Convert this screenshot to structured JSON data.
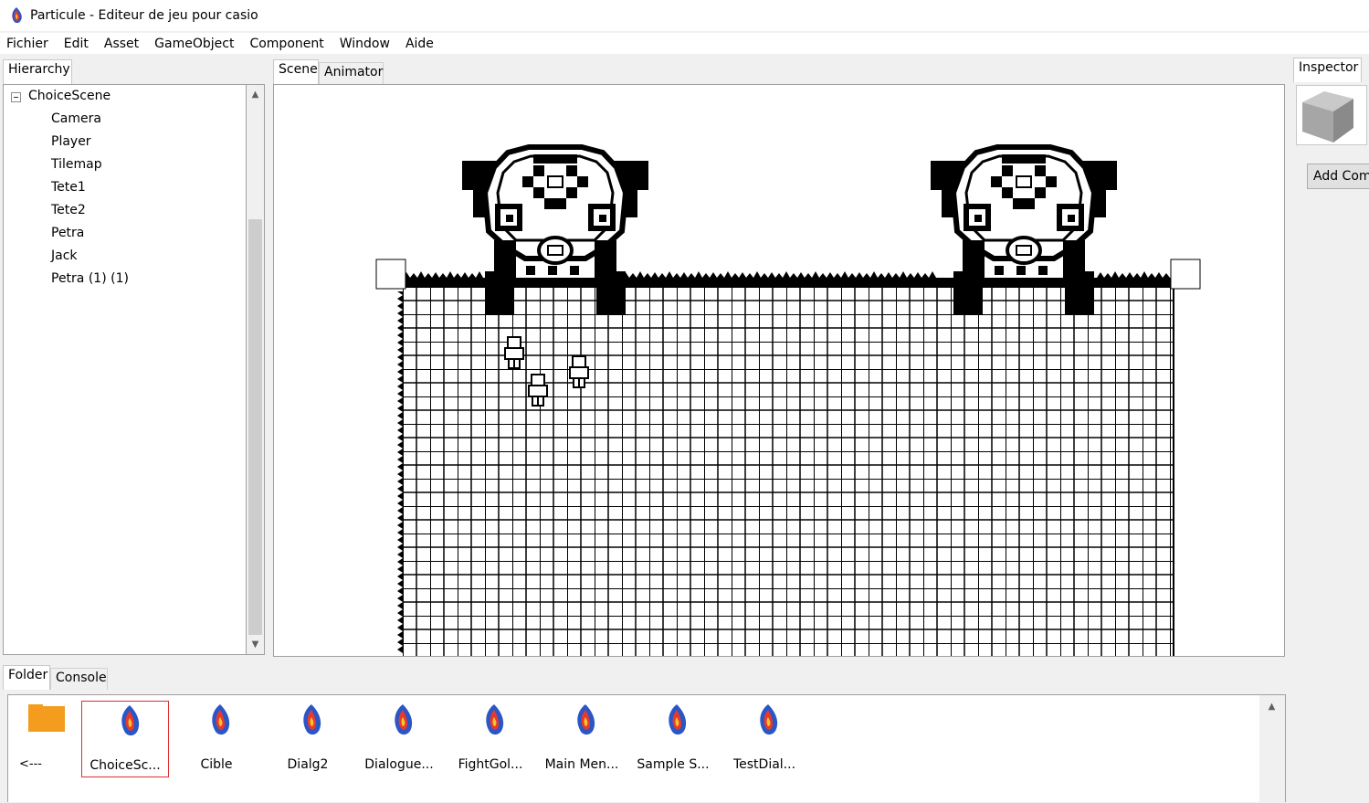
{
  "window": {
    "title": "Particule - Editeur de jeu pour casio"
  },
  "menu": [
    "Fichier",
    "Edit",
    "Asset",
    "GameObject",
    "Component",
    "Window",
    "Aide"
  ],
  "hierarchy": {
    "tab": "Hierarchy",
    "root": "ChoiceScene",
    "children": [
      "Camera",
      "Player",
      "Tilemap",
      "Tete1",
      "Tete2",
      "Petra",
      "Jack",
      "Petra (1) (1)"
    ]
  },
  "scene_tabs": [
    "Scene",
    "Animator"
  ],
  "inspector": {
    "tab": "Inspector",
    "add_component": "Add Com",
    "cube_icon": "cube-icon"
  },
  "bottom_tabs": [
    "Folder",
    "Console"
  ],
  "folder": {
    "back_label": "<---",
    "files": [
      "ChoiceSc...",
      "Cible",
      "Dialg2",
      "Dialogue...",
      "FightGol...",
      "Main Men...",
      "Sample S...",
      "TestDial..."
    ],
    "selected": "ChoiceSc..."
  },
  "colors": {
    "folder": "#f39c1d",
    "selection": "#e03030",
    "panel_bg": "#f0f0f0"
  }
}
